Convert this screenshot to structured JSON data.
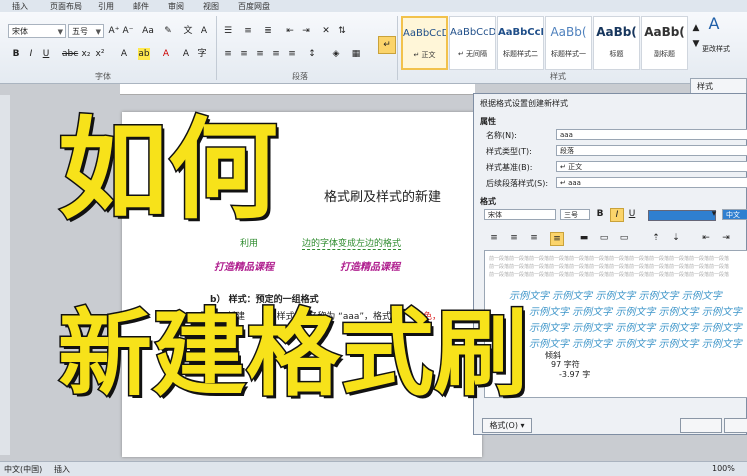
{
  "tabs": [
    "插入",
    "页面布局",
    "引用",
    "邮件",
    "审阅",
    "视图",
    "百度网盘"
  ],
  "ribbon": {
    "font_name": "宋体",
    "font_size": "五号",
    "groups": [
      "字体",
      "段落",
      "样式"
    ],
    "styles": [
      {
        "preview": "AaBbCcDc",
        "name": "↵ 正文"
      },
      {
        "preview": "AaBbCcDc",
        "name": "↵ 无间隔"
      },
      {
        "preview": "AaBbCcI",
        "name": "标题样式二"
      },
      {
        "preview": "AaBb(",
        "name": "标题样式一"
      },
      {
        "preview": "AaBb(",
        "name": "标题"
      },
      {
        "preview": "AaBb(",
        "name": "副标题"
      }
    ],
    "change_styles": "更改样式",
    "styles_pane": "样式"
  },
  "document": {
    "heading": "格式刷及样式的新建",
    "line1_prefix": "利用",
    "line1": "边的字体变成左边的格式",
    "brush_text_1": "打造精品课程",
    "brush_text_2": "打造精品课程",
    "item_b": "b） 样式：预定的一组格式",
    "task_prefix": "题目：新建",
    "task_mid": "“样式”，名称为 “aaa”，格式为",
    "task_colored": "蓝色，倾斜，三号"
  },
  "dialog": {
    "title": "根据格式设置创建新样式",
    "section_props": "属性",
    "name_label": "名称(N):",
    "name_value": "aaa",
    "type_label": "样式类型(T):",
    "type_value": "段落",
    "base_label": "样式基准(B):",
    "base_value": "↵ 正文",
    "next_label": "后续段落样式(S):",
    "next_value": "↵ aaa",
    "section_format": "格式",
    "font_value": "宋体",
    "size_value": "三号",
    "lang_value": "中文",
    "preview_prev": "前一段落前一段落前一段落前一段落前一段落前一段落前一段落前一段落前一段落前一段落前一段落前一段落",
    "sample_text": "示例文字 示例文字 示例文字 示例文字 示例文字",
    "desc_1": "倾斜",
    "desc_2": "97 字符",
    "desc_3": "-3.97 字",
    "format_button": "格式(O) ▾"
  },
  "status": {
    "lang": "中文(中国)",
    "mode": "插入",
    "zoom": "100%"
  },
  "overlay": {
    "line1": "如何",
    "line2": "新建格式刷"
  }
}
